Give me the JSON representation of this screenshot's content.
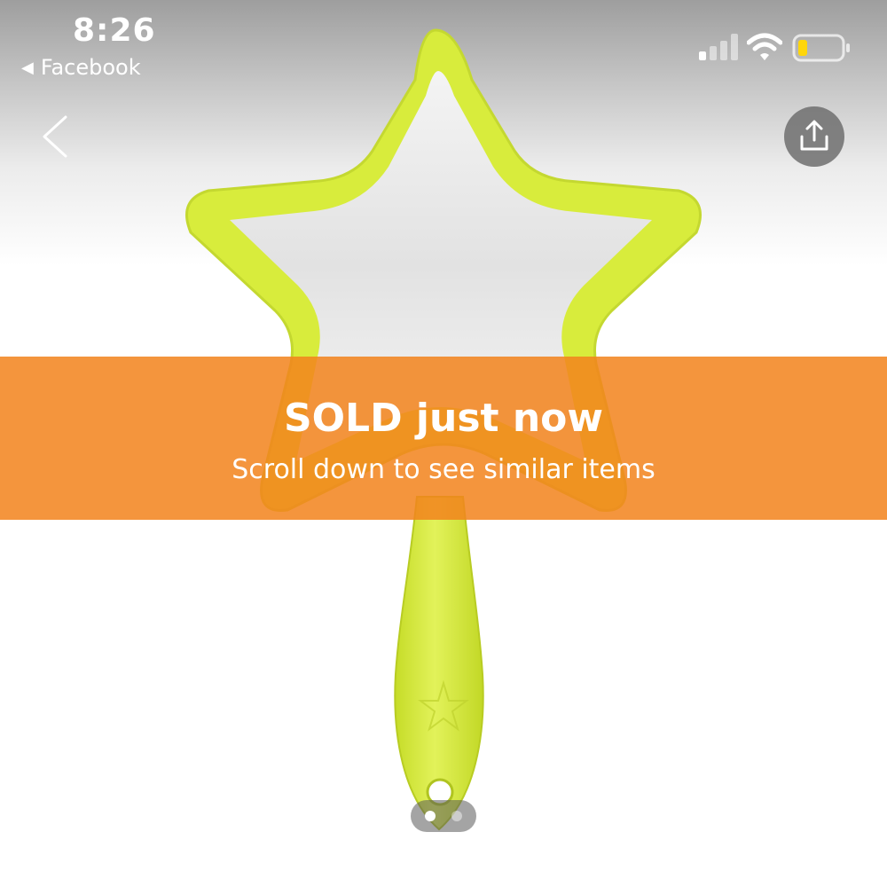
{
  "status_bar": {
    "time": "8:26",
    "back_app_label": "Facebook",
    "back_app_icon": "back-triangle-icon",
    "signal_icon": "cellular-signal-icon",
    "wifi_icon": "wifi-icon",
    "battery_icon": "battery-low-icon"
  },
  "nav": {
    "back_icon": "chevron-left-icon",
    "share_icon": "share-icon"
  },
  "product": {
    "image_description_icon": "star-hand-mirror-image",
    "mirror_color": "#d8ec3c"
  },
  "banner": {
    "title": "SOLD just now",
    "subtitle": "Scroll down to see similar items",
    "color": "#f2831d"
  },
  "gallery": {
    "page_count": 2,
    "current_page": 1
  }
}
